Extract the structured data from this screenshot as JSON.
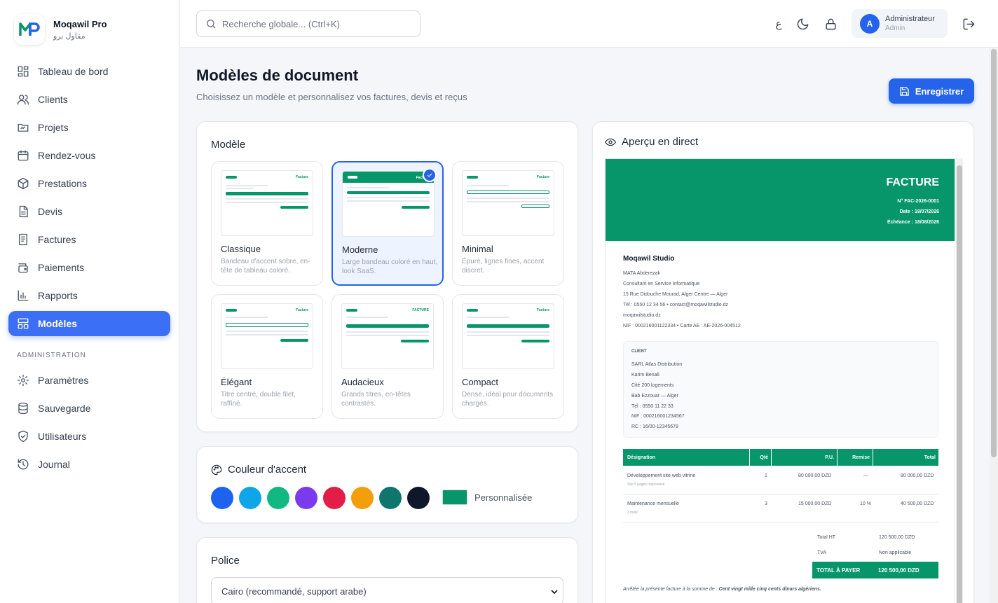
{
  "brand": {
    "name": "Moqawil Pro",
    "subtitle": "مقاول برو"
  },
  "sidebar": {
    "items": [
      {
        "label": "Tableau de bord"
      },
      {
        "label": "Clients"
      },
      {
        "label": "Projets"
      },
      {
        "label": "Rendez-vous"
      },
      {
        "label": "Prestations"
      },
      {
        "label": "Devis"
      },
      {
        "label": "Factures"
      },
      {
        "label": "Paiements"
      },
      {
        "label": "Rapports"
      },
      {
        "label": "Modèles"
      }
    ],
    "admin_title": "ADMINISTRATION",
    "admin_items": [
      {
        "label": "Paramètres"
      },
      {
        "label": "Sauvegarde"
      },
      {
        "label": "Utilisateurs"
      },
      {
        "label": "Journal"
      }
    ]
  },
  "topbar": {
    "search_placeholder": "Recherche globale... (Ctrl+K)",
    "lang_glyph": "ع",
    "user_name": "Administrateur",
    "user_role": "Admin",
    "avatar_letter": "A"
  },
  "page": {
    "title": "Modèles de document",
    "subtitle": "Choisissez un modèle et personnalisez vos factures, devis et reçus",
    "save_label": "Enregistrer"
  },
  "models": {
    "title": "Modèle",
    "templates": [
      {
        "name": "Classique",
        "desc": "Bandeau d'accent sobre, en-tête de tableau coloré.",
        "thumb_label": "Facture"
      },
      {
        "name": "Moderne",
        "desc": "Large bandeau coloré en haut, look SaaS.",
        "thumb_label": "Factu"
      },
      {
        "name": "Minimal",
        "desc": "Épuré, lignes fines, accent discret.",
        "thumb_label": "Facture"
      },
      {
        "name": "Élégant",
        "desc": "Titre centré, double filet, raffiné.",
        "thumb_label": "Facture"
      },
      {
        "name": "Audacieux",
        "desc": "Grands titres, en-têtes contrastés.",
        "thumb_label": "FACTURE"
      },
      {
        "name": "Compact",
        "desc": "Dense, idéal pour documents chargés.",
        "thumb_label": "Facture"
      }
    ]
  },
  "accent": {
    "title": "Couleur d'accent",
    "swatches": [
      "#1e63f0",
      "#0ea5e9",
      "#10b981",
      "#7c3aed",
      "#e11d48",
      "#f59e0b",
      "#0f766e",
      "#0f172a"
    ],
    "custom_color": "#079669",
    "custom_label": "Personnalisée"
  },
  "font": {
    "title": "Police",
    "selected": "Cairo (recommandé, support arabe)"
  },
  "preview": {
    "title": "Aperçu en direct",
    "doc_title": "FACTURE",
    "number": "N° FAC-2026-0001",
    "date": "Date : 19/07/2026",
    "due": "Échéance : 18/08/2026",
    "company": {
      "name": "Moqawil Studio",
      "lines": [
        "MATA Abderezak",
        "Consultant en Service Informatique",
        "15 Rue Didouche Mourad, Alger Centre — Alger",
        "Tél : 0550 12 34 56 • contact@moqawilstudio.dz",
        "moqawilstudio.dz",
        "NIF : 000216001122334 • Carte AE : AE-2026-004512"
      ]
    },
    "client": {
      "label": "CLIENT",
      "lines": [
        "SARL Atlas Distribution",
        "Karim Benali",
        "Cité 200 logements",
        "Bab Ezzouar — Alger",
        "Tél : 0550 11 22 33",
        "NIF : 000216001234567",
        "RC : 16/00-12345678"
      ]
    },
    "table": {
      "headers": [
        "Désignation",
        "Qté",
        "P.U.",
        "Remise",
        "Total"
      ],
      "rows": [
        {
          "designation": "Développement site web vitrine",
          "detail": "Site 5 pages responsive",
          "qty": "1",
          "pu": "80 000,00 DZD",
          "remise": "—",
          "total": "80 000,00 DZD"
        },
        {
          "designation": "Maintenance mensuelle",
          "detail": "3 mois",
          "qty": "3",
          "pu": "15 000,00 DZD",
          "remise": "10 %",
          "total": "40 500,00 DZD"
        }
      ]
    },
    "totals": {
      "ht_label": "Total HT",
      "ht_value": "120 500,00 DZD",
      "tva_label": "TVA",
      "tva_value": "Non applicable",
      "pay_label": "TOTAL À PAYER",
      "pay_value": "120 500,00 DZD"
    },
    "words_prefix": "Arrêtée la présente facture à la somme de :",
    "words_value": "Cent vingt mille cinq cents dinars algériens."
  }
}
